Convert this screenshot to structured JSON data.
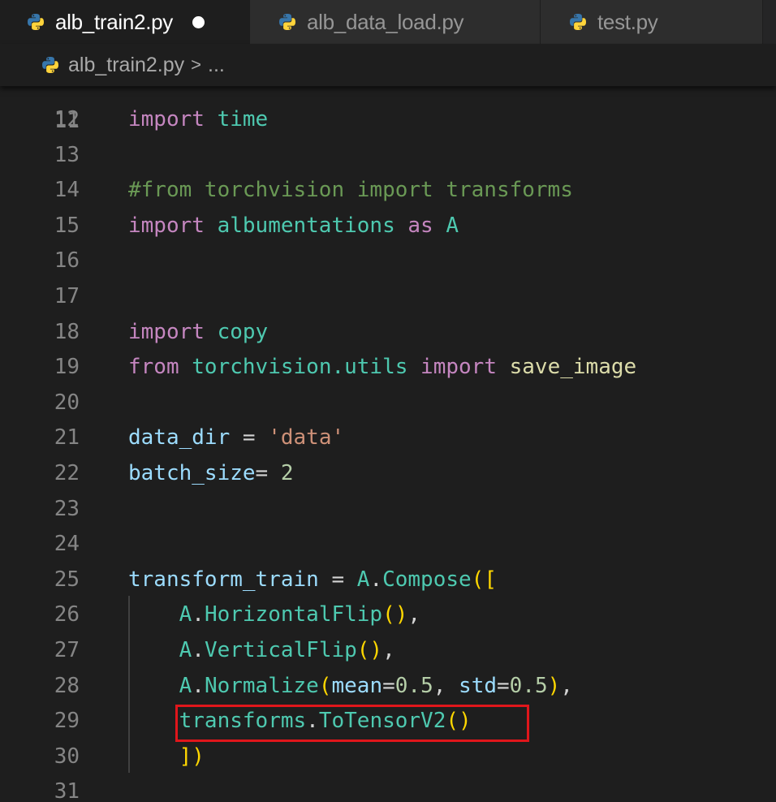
{
  "tabs": [
    {
      "label": "alb_train2.py",
      "active": true,
      "dirty": true
    },
    {
      "label": "alb_data_load.py",
      "active": false,
      "dirty": false
    },
    {
      "label": "test.py",
      "active": false,
      "dirty": false
    }
  ],
  "breadcrumb": {
    "file": "alb_train2.py",
    "separator": ">",
    "ellipsis": "..."
  },
  "icons": {
    "file_type": "python-icon",
    "dirty": "unsaved-dot-icon"
  },
  "colors": {
    "highlight_box": "#e0161b",
    "python_blue": "#3776ab",
    "python_yellow": "#ffd43b"
  },
  "editor": {
    "partial_line_number": "11",
    "lines": [
      {
        "n": "12",
        "t": [
          {
            "k": "kw",
            "v": "import"
          },
          {
            "k": "punc",
            "v": " "
          },
          {
            "k": "mod",
            "v": "time"
          }
        ]
      },
      {
        "n": "13",
        "t": []
      },
      {
        "n": "14",
        "t": [
          {
            "k": "cmt",
            "v": "#from torchvision import transforms"
          }
        ]
      },
      {
        "n": "15",
        "t": [
          {
            "k": "kw",
            "v": "import"
          },
          {
            "k": "punc",
            "v": " "
          },
          {
            "k": "mod",
            "v": "albumentations"
          },
          {
            "k": "punc",
            "v": " "
          },
          {
            "k": "kw",
            "v": "as"
          },
          {
            "k": "punc",
            "v": " "
          },
          {
            "k": "mod",
            "v": "A"
          }
        ]
      },
      {
        "n": "16",
        "t": []
      },
      {
        "n": "17",
        "t": []
      },
      {
        "n": "18",
        "t": [
          {
            "k": "kw",
            "v": "import"
          },
          {
            "k": "punc",
            "v": " "
          },
          {
            "k": "mod",
            "v": "copy"
          }
        ]
      },
      {
        "n": "19",
        "t": [
          {
            "k": "kw",
            "v": "from"
          },
          {
            "k": "punc",
            "v": " "
          },
          {
            "k": "mod",
            "v": "torchvision.utils"
          },
          {
            "k": "punc",
            "v": " "
          },
          {
            "k": "kw",
            "v": "import"
          },
          {
            "k": "punc",
            "v": " "
          },
          {
            "k": "fn",
            "v": "save_image"
          }
        ]
      },
      {
        "n": "20",
        "t": []
      },
      {
        "n": "21",
        "t": [
          {
            "k": "var",
            "v": "data_dir"
          },
          {
            "k": "punc",
            "v": " = "
          },
          {
            "k": "str",
            "v": "'data'"
          }
        ]
      },
      {
        "n": "22",
        "t": [
          {
            "k": "var",
            "v": "batch_size"
          },
          {
            "k": "punc",
            "v": "= "
          },
          {
            "k": "num",
            "v": "2"
          }
        ]
      },
      {
        "n": "23",
        "t": []
      },
      {
        "n": "24",
        "t": []
      },
      {
        "n": "25",
        "t": [
          {
            "k": "var",
            "v": "transform_train"
          },
          {
            "k": "punc",
            "v": " = "
          },
          {
            "k": "mod",
            "v": "A"
          },
          {
            "k": "punc",
            "v": "."
          },
          {
            "k": "mod",
            "v": "Compose"
          },
          {
            "k": "bracket",
            "v": "(["
          }
        ]
      },
      {
        "n": "26",
        "t": [
          {
            "k": "punc",
            "v": "    "
          },
          {
            "k": "mod",
            "v": "A"
          },
          {
            "k": "punc",
            "v": "."
          },
          {
            "k": "mod",
            "v": "HorizontalFlip"
          },
          {
            "k": "bracket",
            "v": "()"
          },
          {
            "k": "punc",
            "v": ","
          }
        ]
      },
      {
        "n": "27",
        "t": [
          {
            "k": "punc",
            "v": "    "
          },
          {
            "k": "mod",
            "v": "A"
          },
          {
            "k": "punc",
            "v": "."
          },
          {
            "k": "mod",
            "v": "VerticalFlip"
          },
          {
            "k": "bracket",
            "v": "()"
          },
          {
            "k": "punc",
            "v": ","
          }
        ]
      },
      {
        "n": "28",
        "t": [
          {
            "k": "punc",
            "v": "    "
          },
          {
            "k": "mod",
            "v": "A"
          },
          {
            "k": "punc",
            "v": "."
          },
          {
            "k": "mod",
            "v": "Normalize"
          },
          {
            "k": "bracket",
            "v": "("
          },
          {
            "k": "var",
            "v": "mean"
          },
          {
            "k": "punc",
            "v": "="
          },
          {
            "k": "num",
            "v": "0.5"
          },
          {
            "k": "punc",
            "v": ", "
          },
          {
            "k": "var",
            "v": "std"
          },
          {
            "k": "punc",
            "v": "="
          },
          {
            "k": "num",
            "v": "0.5"
          },
          {
            "k": "bracket",
            "v": ")"
          },
          {
            "k": "punc",
            "v": ","
          }
        ]
      },
      {
        "n": "29",
        "t": [
          {
            "k": "punc",
            "v": "    "
          },
          {
            "k": "mod",
            "v": "transforms"
          },
          {
            "k": "punc",
            "v": "."
          },
          {
            "k": "mod",
            "v": "ToTensorV2"
          },
          {
            "k": "bracket",
            "v": "()"
          }
        ]
      },
      {
        "n": "30",
        "t": [
          {
            "k": "punc",
            "v": "    "
          },
          {
            "k": "bracket",
            "v": "])"
          }
        ]
      },
      {
        "n": "31",
        "t": []
      }
    ]
  }
}
